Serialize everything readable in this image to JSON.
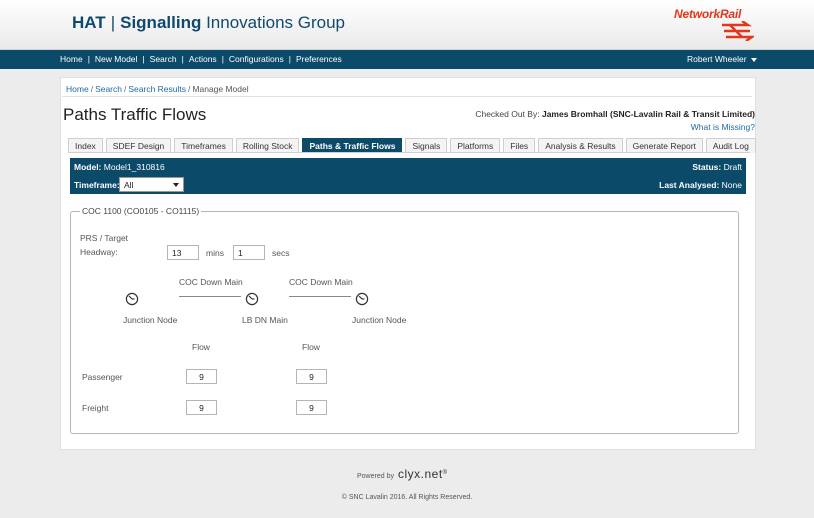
{
  "header": {
    "brand_hat": "HAT",
    "brand_sep": "|",
    "brand_signalling": "Signalling",
    "brand_rest": "Innovations Group",
    "logo_text": "NetworkRail",
    "logo_color": "#e4361b"
  },
  "nav": {
    "items": [
      "Home",
      "New Model",
      "Search",
      "Actions",
      "Configurations",
      "Preferences"
    ],
    "separator": "|",
    "user": "Robert Wheeler"
  },
  "breadcrumb": {
    "home": "Home",
    "search": "Search",
    "results": "Search Results",
    "current": "Manage Model",
    "sep": "/"
  },
  "page": {
    "title": "Paths Traffic Flows",
    "checked_out_label": "Checked Out By:",
    "checked_out_value": "James Bromhall (SNC-Lavalin Rail & Transit Limited)",
    "missing_link": "What is Missing?"
  },
  "tabs": [
    {
      "label": "Index",
      "active": false
    },
    {
      "label": "SDEF Design",
      "active": false
    },
    {
      "label": "Timeframes",
      "active": false
    },
    {
      "label": "Rolling Stock",
      "active": false
    },
    {
      "label": "Paths & Traffic Flows",
      "active": true
    },
    {
      "label": "Signals",
      "active": false
    },
    {
      "label": "Platforms",
      "active": false
    },
    {
      "label": "Files",
      "active": false
    },
    {
      "label": "Analysis & Results",
      "active": false
    },
    {
      "label": "Generate Report",
      "active": false
    },
    {
      "label": "Audit Log",
      "active": false
    }
  ],
  "model_bar": {
    "model_label": "Model:",
    "model_value": "Model1_310816",
    "timeframe_label": "Timeframe:",
    "timeframe_value": "All",
    "status_label": "Status:",
    "status_value": "Draft",
    "last_label": "Last Analysed:",
    "last_value": "None",
    "bar_color": "#0c4a6a"
  },
  "path": {
    "legend": "COC 1100 (CO0105 - CO1115)",
    "prs_label_1": "PRS / Target",
    "prs_label_2": "Headway:",
    "mins_value": "13",
    "mins_unit": "mins",
    "secs_value": "1",
    "secs_unit": "secs",
    "links": [
      "COC Down Main",
      "COC Down Main"
    ],
    "nodes": [
      "Junction Node",
      "LB DN Main",
      "Junction Node"
    ],
    "flow_header": "Flow",
    "rows": [
      {
        "label": "Passenger",
        "flows": [
          "9",
          "9"
        ]
      },
      {
        "label": "Freight",
        "flows": [
          "9",
          "9"
        ]
      }
    ]
  },
  "footer": {
    "powered": "Powered by",
    "clyx": "clyx.net",
    "clyx_mark": "®",
    "copyright": "© SNC Lavalin 2016. All Rights Reserved."
  }
}
